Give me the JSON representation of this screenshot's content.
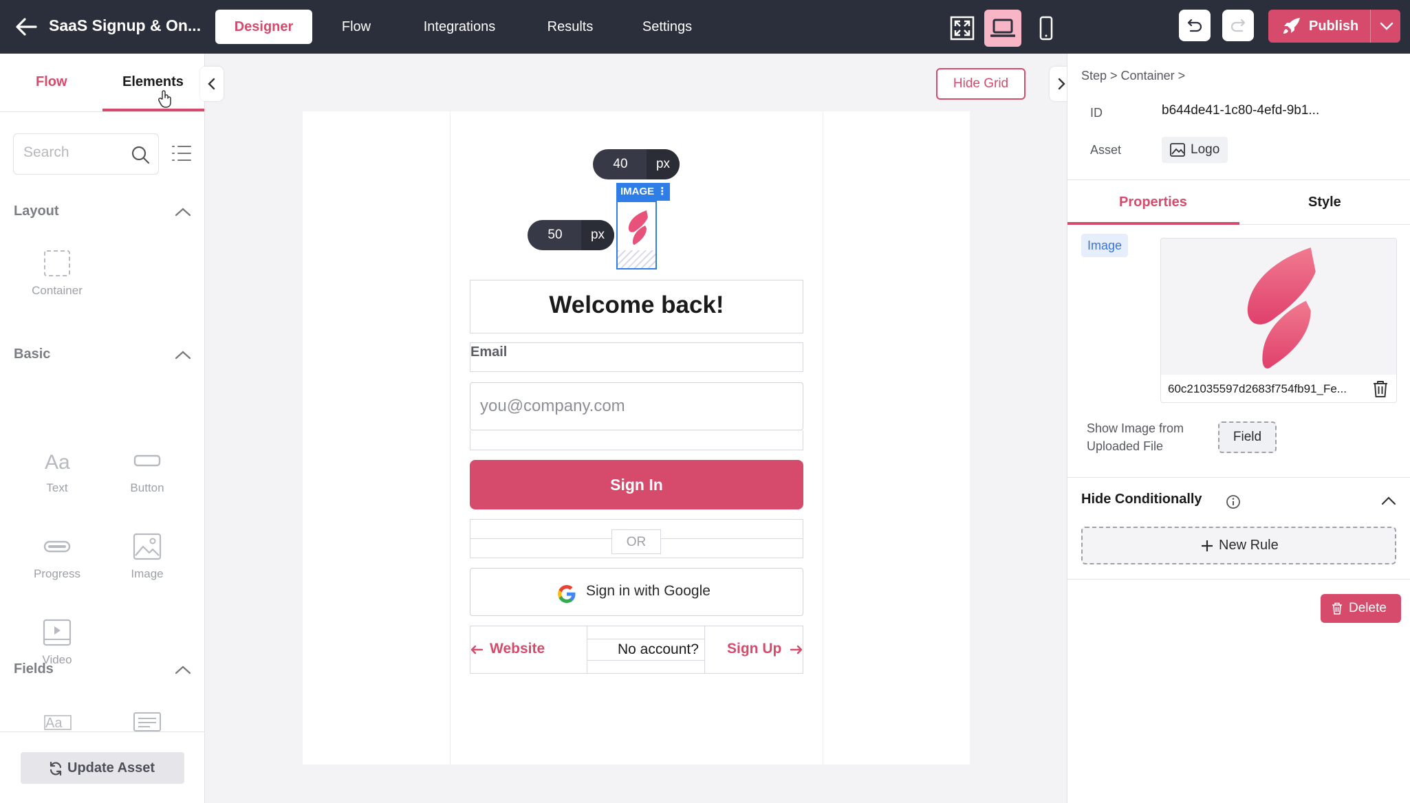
{
  "app": {
    "title": "SaaS Signup & On...",
    "nav_tabs": [
      "Designer",
      "Flow",
      "Integrations",
      "Results",
      "Settings"
    ],
    "publish_label": "Publish",
    "accent_color": "#d64a6b",
    "topbar_color": "#2b2e3b"
  },
  "left_panel": {
    "tabs": [
      "Flow",
      "Elements"
    ],
    "search_placeholder": "Search",
    "sections": {
      "layout": {
        "title": "Layout",
        "items": [
          "Container"
        ]
      },
      "basic": {
        "title": "Basic",
        "items": [
          "Text",
          "Button",
          "Progress",
          "Image",
          "Video"
        ]
      },
      "fields": {
        "title": "Fields"
      }
    },
    "update_asset_label": "Update Asset"
  },
  "canvas": {
    "hide_grid_label": "Hide Grid",
    "spacing_top": {
      "value": "40",
      "unit": "px"
    },
    "spacing_left": {
      "value": "50",
      "unit": "px"
    },
    "image_tag": "IMAGE ⋮",
    "welcome": "Welcome back!",
    "email_label": "Email",
    "email_placeholder": "you@company.com",
    "signin_label": "Sign In",
    "or_label": "OR",
    "google_label": "Sign in with Google",
    "website_link": "Website",
    "no_account_text": "No account?",
    "signup_link": "Sign Up"
  },
  "right_panel": {
    "breadcrumb": "Step  >  Container  >",
    "id_label": "ID",
    "id_value": "b644de41-1c80-4efd-9b1...",
    "asset_label": "Asset",
    "asset_value": "Logo",
    "tabs": [
      "Properties",
      "Style"
    ],
    "image_badge": "Image",
    "file_name": "60c21035597d2683f754fb91_Fe...",
    "show_image_label": [
      "Show Image from",
      "Uploaded File"
    ],
    "field_button": "Field",
    "hide_conditionally": "Hide Conditionally",
    "new_rule_label": "New Rule",
    "delete_label": "Delete"
  }
}
